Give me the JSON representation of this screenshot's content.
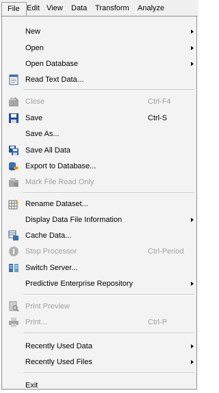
{
  "menubar": {
    "file": "File",
    "edit": "Edit",
    "view": "View",
    "data": "Data",
    "transform": "Transform",
    "analyze": "Analyze"
  },
  "menu": {
    "new": "New",
    "open": "Open",
    "open_database": "Open Database",
    "read_text_data": "Read Text Data...",
    "close": "Close",
    "close_shortcut": "Ctrl-F4",
    "save": "Save",
    "save_shortcut": "Ctrl-S",
    "save_as": "Save As...",
    "save_all_data": "Save All Data",
    "export_to_database": "Export to Database...",
    "mark_read_only": "Mark File Read Only",
    "rename_dataset": "Rename Dataset...",
    "display_info": "Display Data File Information",
    "cache_data": "Cache Data...",
    "stop_processor": "Stop Processor",
    "stop_processor_shortcut": "Ctrl-Period",
    "switch_server": "Switch Server...",
    "predictive_repo": "Predictive Enterprise Repository",
    "print_preview": "Print Preview",
    "print": "Print...",
    "print_shortcut": "Ctrl-P",
    "recently_used_data": "Recently Used Data",
    "recently_used_files": "Recently Used Files",
    "exit": "Exit"
  },
  "colors": {
    "menu_bg": "#f3f3f3",
    "disabled_text": "#a0a0a0",
    "separator": "#c8c8c8"
  }
}
